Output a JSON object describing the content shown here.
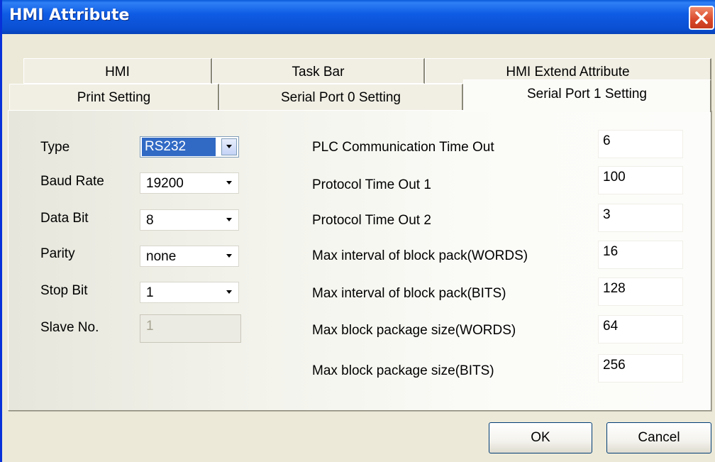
{
  "window": {
    "title": "HMI Attribute"
  },
  "tabs": {
    "row1": [
      {
        "label": "HMI"
      },
      {
        "label": "Task Bar"
      },
      {
        "label": "HMI Extend Attribute"
      }
    ],
    "row2": [
      {
        "label": "Print Setting"
      },
      {
        "label": "Serial Port 0 Setting"
      },
      {
        "label": "Serial Port 1 Setting",
        "active": true
      }
    ]
  },
  "serial": {
    "type_label": "Type",
    "type_value": "RS232",
    "baud_label": "Baud Rate",
    "baud_value": "19200",
    "databit_label": "Data Bit",
    "databit_value": "8",
    "parity_label": "Parity",
    "parity_value": "none",
    "stopbit_label": "Stop Bit",
    "stopbit_value": "1",
    "slave_label": "Slave No.",
    "slave_value": "1"
  },
  "timing": [
    {
      "label": "PLC Communication Time Out",
      "value": "6"
    },
    {
      "label": "Protocol Time Out 1",
      "value": "100"
    },
    {
      "label": "Protocol Time Out 2",
      "value": "3"
    },
    {
      "label": "Max interval of block pack(WORDS)",
      "value": "16"
    },
    {
      "label": "Max interval of block pack(BITS)",
      "value": "128"
    },
    {
      "label": "Max block package size(WORDS)",
      "value": "64"
    },
    {
      "label": "Max block package size(BITS)",
      "value": "256"
    }
  ],
  "buttons": {
    "ok": "OK",
    "cancel": "Cancel"
  },
  "colors": {
    "titlebar": "#0a4fd2",
    "close": "#d9482a",
    "selection": "#316ac5"
  }
}
